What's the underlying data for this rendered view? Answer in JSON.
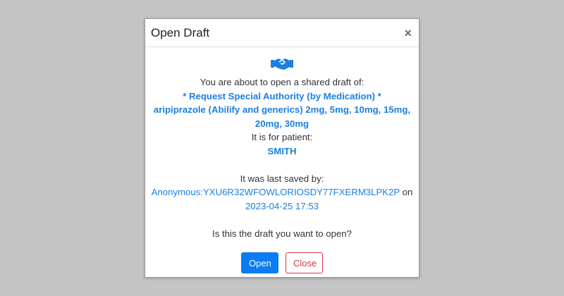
{
  "dialog": {
    "title": "Open Draft",
    "close_glyph": "×",
    "icon": "handshake-icon",
    "intro": "You are about to open a shared draft of:",
    "draft_line1": "* Request Special Authority (by Medication) *",
    "draft_line2": "aripiprazole (Abilify and generics) 2mg, 5mg, 10mg, 15mg, 20mg, 30mg",
    "patient_label": "It is for patient:",
    "patient_name": "SMITH",
    "saved_label": "It was last saved by:",
    "saved_user": "Anonymous:YXU6R32WFOWLORIOSDY77FXERM3LPK2P",
    "saved_on": "on",
    "saved_time": "2023-04-25 17:53",
    "question": "Is this the draft you want to open?",
    "open_label": "Open",
    "close_label": "Close"
  },
  "colors": {
    "overlay": "#c4c4c4",
    "accent": "#1b7fe0",
    "primary_button": "#0d7bf2",
    "danger": "#dc3545"
  }
}
